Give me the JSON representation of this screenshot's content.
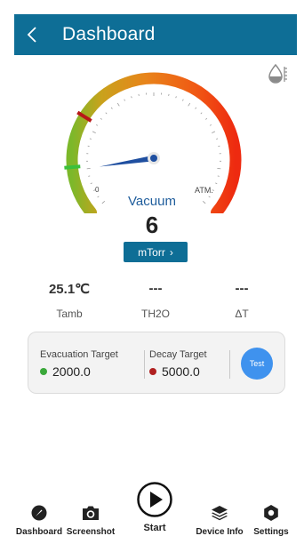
{
  "header": {
    "title": "Dashboard"
  },
  "gauge": {
    "label": "Vacuum",
    "value": "6",
    "unit": "mTorr",
    "min_label": "0",
    "max_label": "ATM.",
    "needle_fraction": 0.12,
    "colors": {
      "green": "#6aaa2a",
      "orange": "#e07a10",
      "red": "#ee3a10",
      "needle": "#1f4fa0"
    }
  },
  "readings": [
    {
      "value": "25.1℃",
      "label": "Tamb"
    },
    {
      "value": "---",
      "label": "TH2O"
    },
    {
      "value": "---",
      "label": "ΔT"
    }
  ],
  "targets": {
    "evacuation": {
      "label": "Evacuation Target",
      "value": "2000.0",
      "color": "#3aa83a"
    },
    "decay": {
      "label": "Decay Target",
      "value": "5000.0",
      "color": "#b02020"
    },
    "test_label": "Test"
  },
  "nav": {
    "dashboard": "Dashboard",
    "screenshot": "Screenshot",
    "start": "Start",
    "device_info": "Device Info",
    "settings": "Settings"
  },
  "icons": {
    "back": "chevron-left-icon",
    "drop": "water-drop-icon",
    "unit_chevron": "chevron-right-icon",
    "dashboard": "gauge-icon",
    "screenshot": "camera-icon",
    "start": "play-icon",
    "device_info": "layers-icon",
    "settings": "gear-icon"
  }
}
